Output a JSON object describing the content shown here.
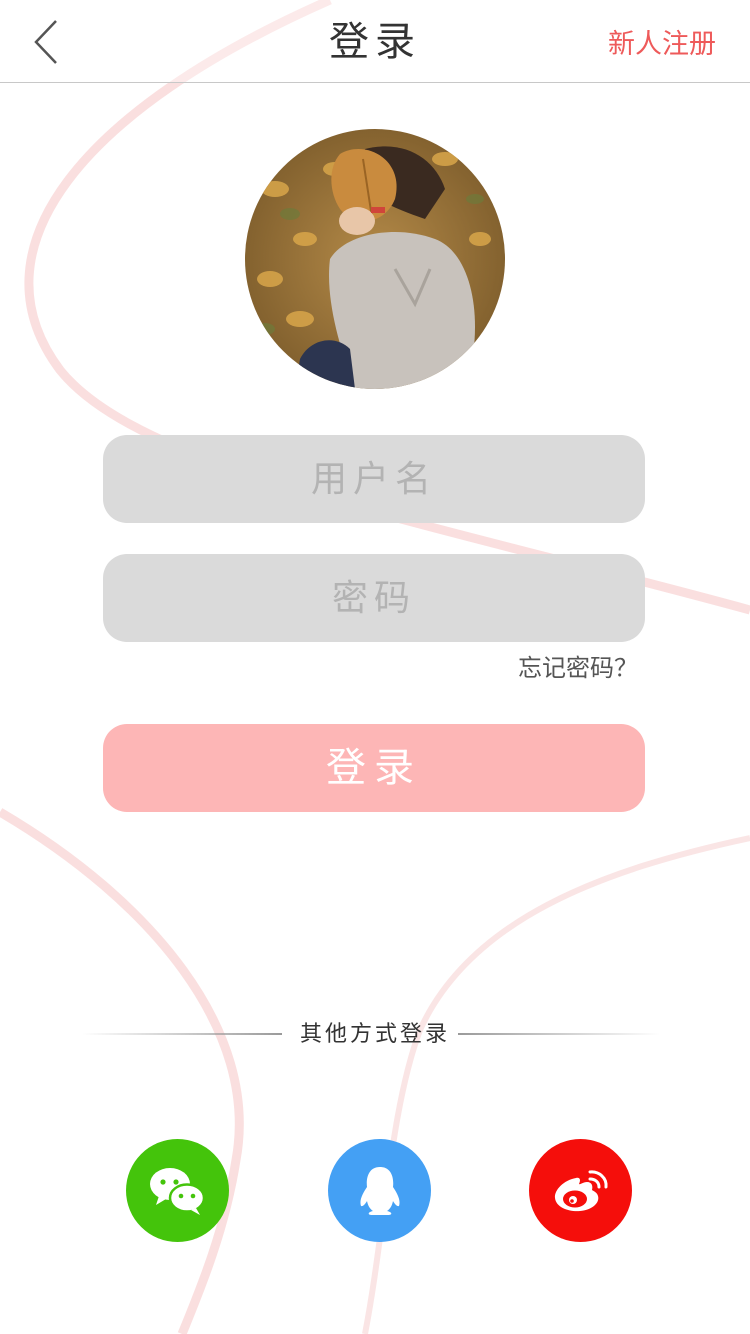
{
  "header": {
    "title": "登录",
    "register_label": "新人注册"
  },
  "form": {
    "username_placeholder": "用户名",
    "password_placeholder": "密码",
    "forgot_label": "忘记密码？",
    "login_label": "登录"
  },
  "other_login": {
    "label": "其他方式登录",
    "providers": [
      {
        "name": "wechat",
        "icon": "wechat-icon",
        "color": "#44c40b"
      },
      {
        "name": "qq",
        "icon": "qq-icon",
        "color": "#44a0f4"
      },
      {
        "name": "weibo",
        "icon": "weibo-icon",
        "color": "#f50e0b"
      }
    ]
  },
  "colors": {
    "accent": "#ee5a5a",
    "login_button": "#fdb6b6",
    "input_background": "#dadada"
  }
}
